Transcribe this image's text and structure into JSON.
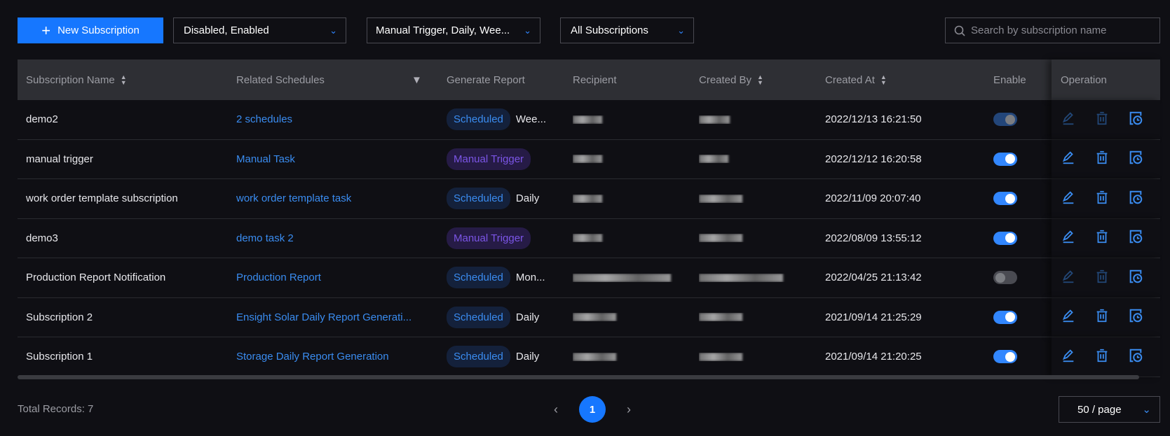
{
  "toolbar": {
    "new_label": "New Subscription",
    "filter_status": "Disabled, Enabled",
    "filter_trigger": "Manual Trigger, Daily, Wee...",
    "filter_scope": "All Subscriptions",
    "search_placeholder": "Search by subscription name"
  },
  "columns": [
    "Subscription Name",
    "Related Schedules",
    "Generate Report",
    "Recipient",
    "Created By",
    "Created At",
    "Enable",
    "Operation"
  ],
  "rows": [
    {
      "name": "demo2",
      "schedule": "2 schedules",
      "tag": "Scheduled",
      "freq": "Wee...",
      "created_at": "2022/12/13 16:21:50",
      "enable": "disabled-on"
    },
    {
      "name": "manual trigger",
      "schedule": "Manual Task",
      "tag": "Manual Trigger",
      "freq": "",
      "created_at": "2022/12/12 16:20:58",
      "enable": "on"
    },
    {
      "name": "work order template subscription",
      "schedule": "work order template task",
      "tag": "Scheduled",
      "freq": "Daily",
      "created_at": "2022/11/09 20:07:40",
      "enable": "on"
    },
    {
      "name": "demo3",
      "schedule": "demo task 2",
      "tag": "Manual Trigger",
      "freq": "",
      "created_at": "2022/08/09 13:55:12",
      "enable": "on"
    },
    {
      "name": "Production Report Notification",
      "schedule": "Production Report",
      "tag": "Scheduled",
      "freq": "Mon...",
      "created_at": "2022/04/25 21:13:42",
      "enable": "off"
    },
    {
      "name": "Subscription 2",
      "schedule": "Ensight Solar Daily Report Generati...",
      "tag": "Scheduled",
      "freq": "Daily",
      "created_at": "2021/09/14 21:25:29",
      "enable": "on"
    },
    {
      "name": "Subscription 1",
      "schedule": "Storage Daily Report Generation",
      "tag": "Scheduled",
      "freq": "Daily",
      "created_at": "2021/09/14 21:20:25",
      "enable": "on"
    }
  ],
  "footer": {
    "total": "Total Records: 7",
    "page": "1",
    "page_size": "50 / page"
  },
  "colors": {
    "accent": "#1677ff",
    "link": "#3a8cf0",
    "manual_tag": "#7b55e6"
  }
}
